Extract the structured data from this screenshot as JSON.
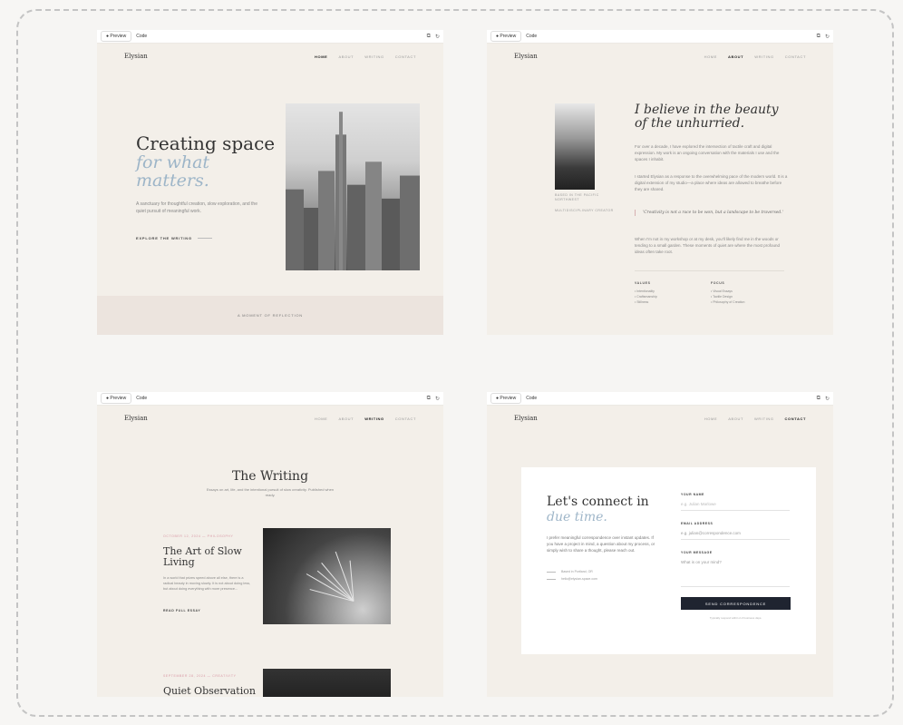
{
  "toolbar": {
    "preview_label": "● Preview",
    "code_label": "Code",
    "icons": [
      "copy-icon",
      "refresh-icon"
    ]
  },
  "site": {
    "logo": "Elysian",
    "nav": [
      "HOME",
      "ABOUT",
      "WRITING",
      "CONTACT"
    ]
  },
  "home": {
    "title": "Creating space",
    "title_italic": "for what matters.",
    "description": "A sanctuary for thoughtful creation, slow exploration, and the quiet pursuit of meaningful work.",
    "cta": "EXPLORE THE WRITING",
    "band_text": "A MOMENT OF REFLECTION"
  },
  "about": {
    "caption_1": "BASED IN THE PACIFIC NORTHWEST",
    "caption_2": "MULTIDISCIPLINARY CREATOR",
    "title": "I believe in the beauty of the unhurried.",
    "p1": "For over a decade, I have explored the intersection of tactile craft and digital expression. My work is an ongoing conversation with the materials I use and the spaces I inhabit.",
    "p2": "I started Elysian as a response to the overwhelming pace of the modern world. It is a digital extension of my studio—a place where ideas are allowed to breathe before they are shared.",
    "quote": "'Creativity is not a race to be won, but a landscape to be traversed.'",
    "p3": "When I'm not in my workshop or at my desk, you'll likely find me in the woods or tending to a small garden. These moments of quiet are where the most profound ideas often take root.",
    "values_heading": "VALUES",
    "values": [
      "• Intentionality",
      "• Craftsmanship",
      "• Stillness"
    ],
    "focus_heading": "FOCUS",
    "focus": [
      "• Visual Essays",
      "• Tactile Design",
      "• Philosophy of Creation"
    ]
  },
  "writing": {
    "title": "The Writing",
    "subtitle": "Essays on art, life, and the intentional pursuit of slow creativity. Published when ready.",
    "entries": [
      {
        "meta": "OCTOBER 12, 2024 — PHILOSOPHY",
        "title": "The Art of Slow Living",
        "excerpt": "In a world that prizes speed above all else, there is a radical beauty in moving slowly. It is not about doing less, but about doing everything with more presence...",
        "link": "READ FULL ESSAY"
      },
      {
        "meta": "SEPTEMBER 28, 2024 — CREATIVITY",
        "title": "Quiet Observation"
      }
    ]
  },
  "contact": {
    "title": "Let's connect in",
    "title_italic": "due time.",
    "description": "I prefer meaningful correspondence over instant updates. If you have a project in mind, a question about my process, or simply wish to share a thought, please reach out.",
    "location": "Based in Portland, OR",
    "email": "hello@elysian-space.com",
    "name_label": "YOUR NAME",
    "name_placeholder": "e.g. Julian Marlowe",
    "email_label": "EMAIL ADDRESS",
    "email_placeholder": "e.g. julian@correspondence.com",
    "message_label": "YOUR MESSAGE",
    "message_placeholder": "What is on your mind?",
    "submit": "SEND CORRESPONDENCE",
    "note": "Typically respond within 2-3 business days."
  }
}
